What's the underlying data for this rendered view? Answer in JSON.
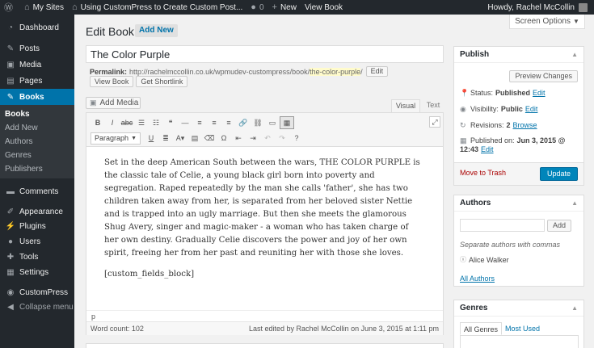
{
  "admin_bar": {
    "my_sites": "My Sites",
    "site_name": "Using CustomPress to Create Custom Post...",
    "comments_count": "0",
    "new_label": "New",
    "view_book": "View Book",
    "howdy": "Howdy, Rachel McCollin"
  },
  "sidebar": {
    "items": [
      {
        "label": "Dashboard",
        "icon": "dashboard-icon"
      },
      {
        "label": "Posts",
        "icon": "pin-icon"
      },
      {
        "label": "Media",
        "icon": "media-icon"
      },
      {
        "label": "Pages",
        "icon": "pages-icon"
      },
      {
        "label": "Books",
        "icon": "pin-icon"
      },
      {
        "label": "Comments",
        "icon": "comment-icon"
      },
      {
        "label": "Appearance",
        "icon": "brush-icon"
      },
      {
        "label": "Plugins",
        "icon": "plug-icon"
      },
      {
        "label": "Users",
        "icon": "user-icon"
      },
      {
        "label": "Tools",
        "icon": "wrench-icon"
      },
      {
        "label": "Settings",
        "icon": "settings-icon"
      },
      {
        "label": "CustomPress",
        "icon": "custompress-icon"
      },
      {
        "label": "Collapse menu",
        "icon": "collapse-icon"
      }
    ],
    "books_submenu": [
      "Books",
      "Add New",
      "Authors",
      "Genres",
      "Publishers"
    ]
  },
  "screen_options": "Screen Options",
  "page": {
    "title": "Edit Book",
    "add_new": "Add New"
  },
  "post": {
    "title": "The Color Purple",
    "permalink_label": "Permalink:",
    "permalink_base": "http://rachelmccollin.co.uk/wpmudev-custompress/book/",
    "permalink_slug": "the-color-purple",
    "permalink_end": "/",
    "edit_label": "Edit",
    "view_book": "View Book",
    "get_shortlink": "Get Shortlink"
  },
  "editor": {
    "add_media": "Add Media",
    "tab_visual": "Visual",
    "tab_text": "Text",
    "format": "Paragraph",
    "content": [
      "Set in the deep American South between the wars, THE COLOR PURPLE is the classic tale of Celie, a young black girl born into poverty and segregation. Raped repeatedly by the man she calls 'father', she has two children taken away from her, is separated from her beloved sister Nettie and is trapped into an ugly marriage. But then she meets the glamorous Shug Avery, singer and magic-maker - a woman who has taken charge of her own destiny. Gradually Celie discovers the power and joy of her own spirit, freeing her from her past and reuniting her with those she loves.",
      "[custom_fields_block]"
    ],
    "path": "p",
    "word_count": "Word count: 102",
    "last_edited": "Last edited by Rachel McCollin on June 3, 2015 at 1:11 pm"
  },
  "publish": {
    "heading": "Publish",
    "preview": "Preview Changes",
    "status_label": "Status:",
    "status_value": "Published",
    "visibility_label": "Visibility:",
    "visibility_value": "Public",
    "revisions_label": "Revisions:",
    "revisions_value": "2",
    "browse": "Browse",
    "published_label": "Published on:",
    "published_line1": "Jun 3, 2015 @",
    "published_line2": "12:43",
    "edit": "Edit",
    "trash": "Move to Trash",
    "update": "Update"
  },
  "authors": {
    "heading": "Authors",
    "add": "Add",
    "hint": "Separate authors with commas",
    "item": "Alice Walker",
    "all": "All Authors"
  },
  "genres": {
    "heading": "Genres",
    "tab_all": "All Genres",
    "tab_most": "Most Used"
  },
  "colors": {
    "admin_dark": "#23282d",
    "accent": "#0073aa",
    "button_primary": "#0085ba",
    "trash": "#aa0000"
  }
}
